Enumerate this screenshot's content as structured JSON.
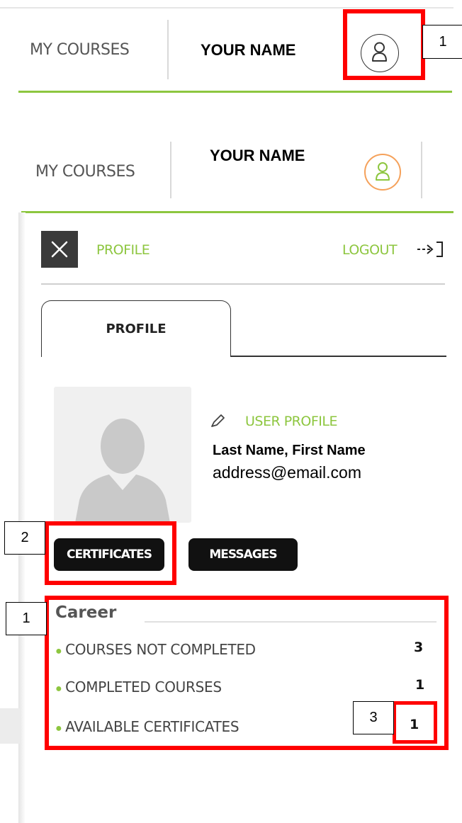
{
  "header_top": {
    "my_courses": "MY COURSES",
    "your_name": "YOUR NAME"
  },
  "header_open": {
    "my_courses": "MY COURSES",
    "your_name": "YOUR NAME"
  },
  "panel": {
    "profile_link": "PROFILE",
    "logout_link": "LOGOUT",
    "logout_icon": "⇢]",
    "tab_profile": "PROFILE",
    "user_profile_link": "USER PROFILE",
    "user_name": "Last Name, First Name",
    "user_email": "address@email.com",
    "certificates_button": "CERTIFICATES",
    "messages_button": "MESSAGES",
    "career": {
      "title": "Career",
      "stats": [
        {
          "label": "COURSES NOT COMPLETED",
          "value": "3"
        },
        {
          "label": "COMPLETED COURSES",
          "value": "1"
        },
        {
          "label": "AVAILABLE CERTIFICATES",
          "value": "1"
        }
      ]
    }
  },
  "callouts": {
    "avatar": "1",
    "certificates": "2",
    "career": "1",
    "available_certificates": "3"
  },
  "colors": {
    "accent_green": "#8dc63f",
    "highlight_red": "#ff0000",
    "avatar_orange": "#f5a15a"
  }
}
